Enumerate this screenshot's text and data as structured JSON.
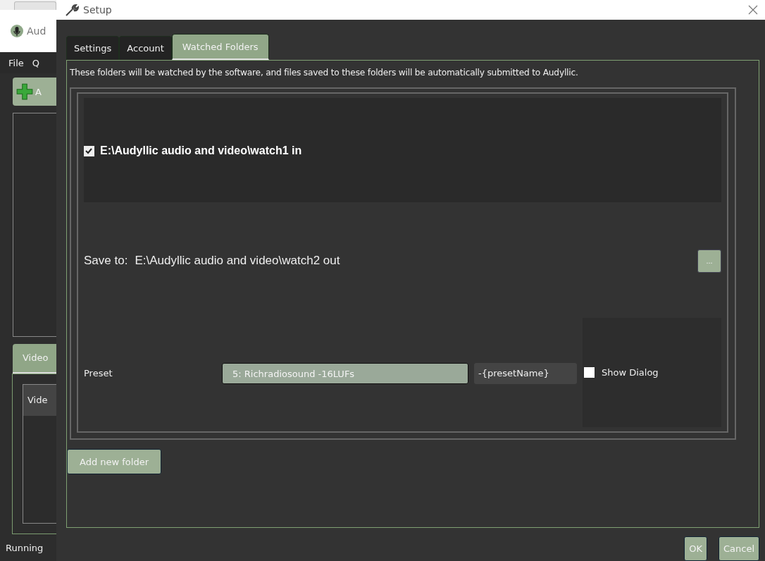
{
  "background_window": {
    "title": "Aud",
    "menu": [
      "File",
      "Q"
    ],
    "add_button": "A",
    "tabs": [
      {
        "label": "Video",
        "selected": true
      }
    ],
    "table": {
      "columns": [
        "Vide"
      ]
    },
    "status_bar": "Running"
  },
  "dialog": {
    "title": "Setup",
    "tabs": [
      {
        "label": "Settings",
        "selected": false
      },
      {
        "label": "Account",
        "selected": false
      },
      {
        "label": "Watched Folders",
        "selected": true
      }
    ],
    "description": "These folders will be watched by the software, and files saved to these folders will be automatically submitted to Audyllic.",
    "folders": [
      {
        "path": "E:\\Audyllic audio and video\\watch1 in",
        "checked": true,
        "save_to_label": "Save to:",
        "save_to": "E:\\Audyllic audio and video\\watch2 out",
        "browse_button": "...",
        "preset_label": "Preset",
        "preset": "5: Richradiosound -16LUFs",
        "suffix": "-{presetName}",
        "show_dialog": {
          "label": "Show Dialog",
          "checked": false
        }
      }
    ],
    "add_button": "Add new folder",
    "buttons": [
      "OK",
      "Cancel"
    ]
  }
}
